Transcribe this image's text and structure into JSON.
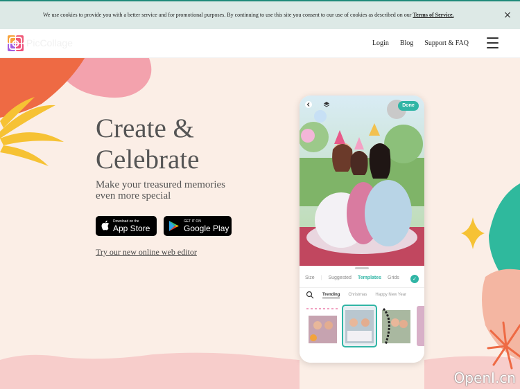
{
  "cookie": {
    "text": "We use cookies to provide you with a better service and for promotional purposes. By continuing to use this site you consent to our use of cookies as described on our",
    "link": "Terms of Service.",
    "close": "×"
  },
  "header": {
    "logo_text": "PicCollage",
    "nav": [
      "Login",
      "Blog",
      "Support & FAQ"
    ]
  },
  "hero": {
    "title_line1": "Create &",
    "title_line2": "Celebrate",
    "subtitle_line1": "Make your treasured memories",
    "subtitle_line2": "even more special",
    "appstore_small": "Download on the",
    "appstore_big": "App Store",
    "googleplay_small": "GET IT ON",
    "googleplay_big": "Google Play",
    "web_editor_link": "Try our new online web editor"
  },
  "phone": {
    "done": "Done",
    "tabs": [
      "Size",
      "Suggested",
      "Templates",
      "Grids"
    ],
    "active_tab": "Templates",
    "subtabs": [
      "Trending",
      "Christmas",
      "Happy New Year"
    ],
    "active_subtab": "Trending"
  },
  "watermark": "OpenI.cn",
  "colors": {
    "accent": "#30b5a5",
    "background": "#fbeee6",
    "banner": "#dde9e6"
  }
}
